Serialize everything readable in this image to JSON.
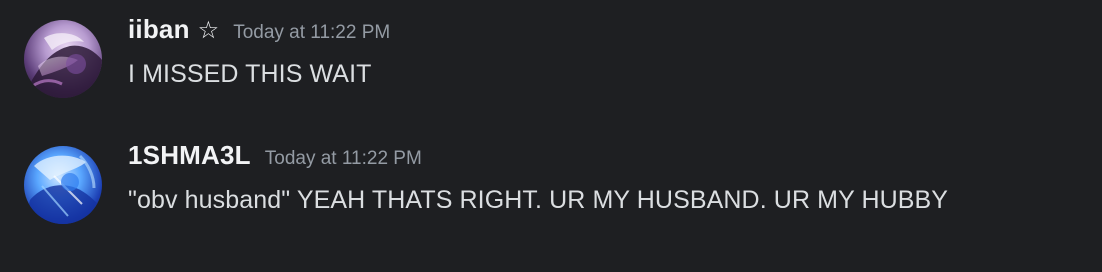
{
  "messages": [
    {
      "username": "iiban",
      "badge": "☆",
      "timestamp": "Today at 11:22 PM",
      "content": "I MISSED THIS WAIT",
      "avatar_icon": "user-avatar-icon"
    },
    {
      "username": "1SHMA3L",
      "timestamp": "Today at 11:22 PM",
      "content": "\"obv husband\" YEAH THATS RIGHT. UR MY HUSBAND. UR MY HUBBY",
      "avatar_icon": "user-avatar-icon"
    }
  ],
  "colors": {
    "background": "#1e1f22",
    "username": "#f2f3f5",
    "timestamp": "#949ba4",
    "message_text": "#dbdee1"
  }
}
